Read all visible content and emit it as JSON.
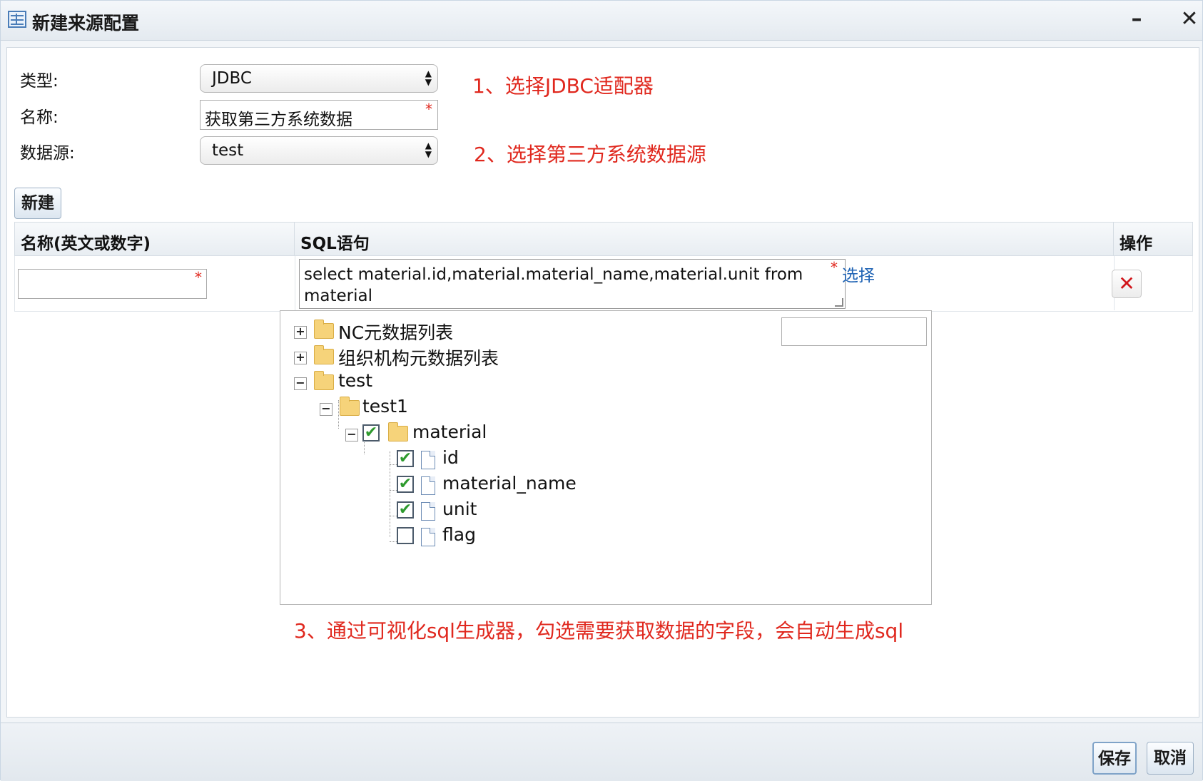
{
  "window": {
    "title": "新建来源配置",
    "minimize_label": "–",
    "close_label": "✕"
  },
  "form": {
    "type_label": "类型:",
    "type_value": "JDBC",
    "name_label": "名称:",
    "name_value": "获取第三方系统数据",
    "datasource_label": "数据源:",
    "datasource_value": "test",
    "required_mark": "*"
  },
  "annotations": {
    "step1": "1、选择JDBC适配器",
    "step2": "2、选择第三方系统数据源",
    "step3": "3、通过可视化sql生成器，勾选需要获取数据的字段，会自动生成sql"
  },
  "toolbar": {
    "new_button": "新建"
  },
  "grid": {
    "headers": [
      "名称(英文或数字)",
      "SQL语句",
      "操作"
    ],
    "row": {
      "name_value": "",
      "sql_value": "select material.id,material.material_name,material.unit from material",
      "select_link": "选择",
      "delete_icon": "✕"
    }
  },
  "tree": {
    "search_value": "",
    "nodes": [
      {
        "label": "NC元数据列表",
        "expanded": false
      },
      {
        "label": "组织机构元数据列表",
        "expanded": false
      },
      {
        "label": "test",
        "expanded": true
      },
      {
        "label": "test1",
        "expanded": true
      },
      {
        "label": "material",
        "expanded": true,
        "checked": true
      },
      {
        "label": "id",
        "checked": true
      },
      {
        "label": "material_name",
        "checked": true
      },
      {
        "label": "unit",
        "checked": true
      },
      {
        "label": "flag",
        "checked": false
      }
    ],
    "expand_symbol": "+",
    "collapse_symbol": "−",
    "check_symbol": "✔"
  },
  "footer": {
    "save_button": "保存",
    "cancel_button": "取消"
  },
  "colors": {
    "annotation": "#e0281e",
    "link": "#1f63b4",
    "delete": "#d1161b",
    "check": "#2e9a2e"
  }
}
